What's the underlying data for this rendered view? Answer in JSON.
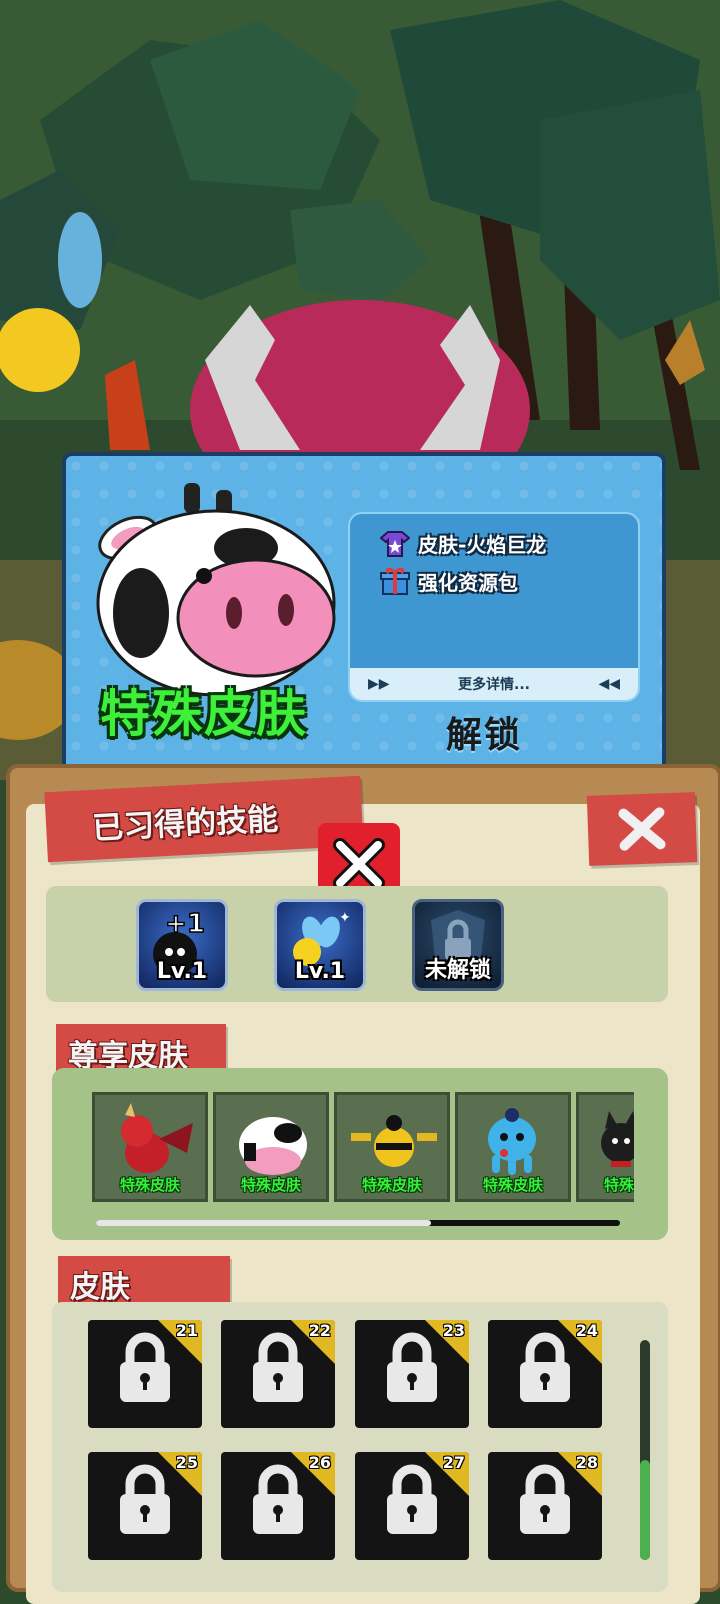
{
  "promo": {
    "title": "特殊皮肤",
    "rewards": [
      {
        "label": "皮肤-火焰巨龙",
        "icon": "shirt-icon"
      },
      {
        "label": "强化资源包",
        "icon": "gift-icon"
      }
    ],
    "more_details": "更多详情...",
    "unlock_label": "解锁"
  },
  "skills": {
    "header": "已习得的技能",
    "items": [
      {
        "label": "Lv.1",
        "icon": "bomb-plus-one-icon",
        "badge": "+1"
      },
      {
        "label": "Lv.1",
        "icon": "fairy-icon"
      },
      {
        "label": "未解锁",
        "icon": "lock-shield-icon"
      }
    ]
  },
  "exclusive_skins": {
    "header": "尊享皮肤",
    "items": [
      {
        "label": "特殊皮肤",
        "icon": "red-dragon-icon"
      },
      {
        "label": "特殊皮肤",
        "icon": "cow-icon"
      },
      {
        "label": "特殊皮肤",
        "icon": "bee-robot-icon"
      },
      {
        "label": "特殊皮肤",
        "icon": "blue-octopus-icon"
      },
      {
        "label": "特殊皮肤",
        "icon": "black-cat-icon"
      }
    ],
    "scroll_fraction": 0.64
  },
  "skins": {
    "header": "皮肤",
    "items": [
      {
        "number": "21"
      },
      {
        "number": "22"
      },
      {
        "number": "23"
      },
      {
        "number": "24"
      },
      {
        "number": "25"
      },
      {
        "number": "26"
      },
      {
        "number": "27"
      },
      {
        "number": "28"
      }
    ]
  },
  "colors": {
    "accent_red": "#d44a44",
    "skin_name_green": "#35f03a",
    "promo_blue": "#5db2e6"
  }
}
